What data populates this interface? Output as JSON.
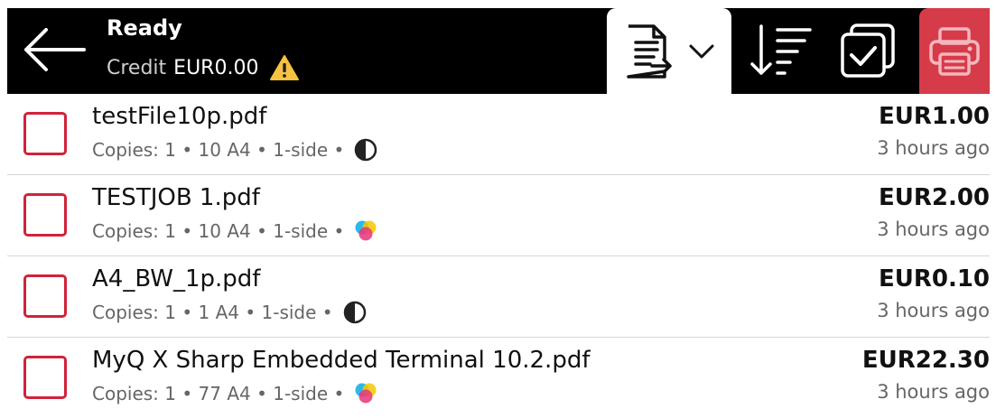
{
  "header": {
    "status": "Ready",
    "credit_label": "Credit",
    "credit_value": "EUR0.00",
    "warning_icon": "warning-icon",
    "print_color": "#d63b49"
  },
  "jobs": [
    {
      "name": "testFile10p.pdf",
      "meta": "Copies: 1 • 10 A4 • 1-side •",
      "color_mode": "bw",
      "price": "EUR1.00",
      "time": "3 hours ago"
    },
    {
      "name": "TESTJOB 1.pdf",
      "meta": "Copies: 1 • 10 A4 • 1-side •",
      "color_mode": "color",
      "price": "EUR2.00",
      "time": "3 hours ago"
    },
    {
      "name": "A4_BW_1p.pdf",
      "meta": "Copies: 1 • 1 A4 • 1-side •",
      "color_mode": "bw",
      "price": "EUR0.10",
      "time": "3 hours ago"
    },
    {
      "name": "MyQ X Sharp Embedded Terminal 10.2.pdf",
      "meta": "Copies: 1 • 77 A4 • 1-side •",
      "color_mode": "color",
      "price": "EUR22.30",
      "time": "3 hours ago"
    }
  ]
}
